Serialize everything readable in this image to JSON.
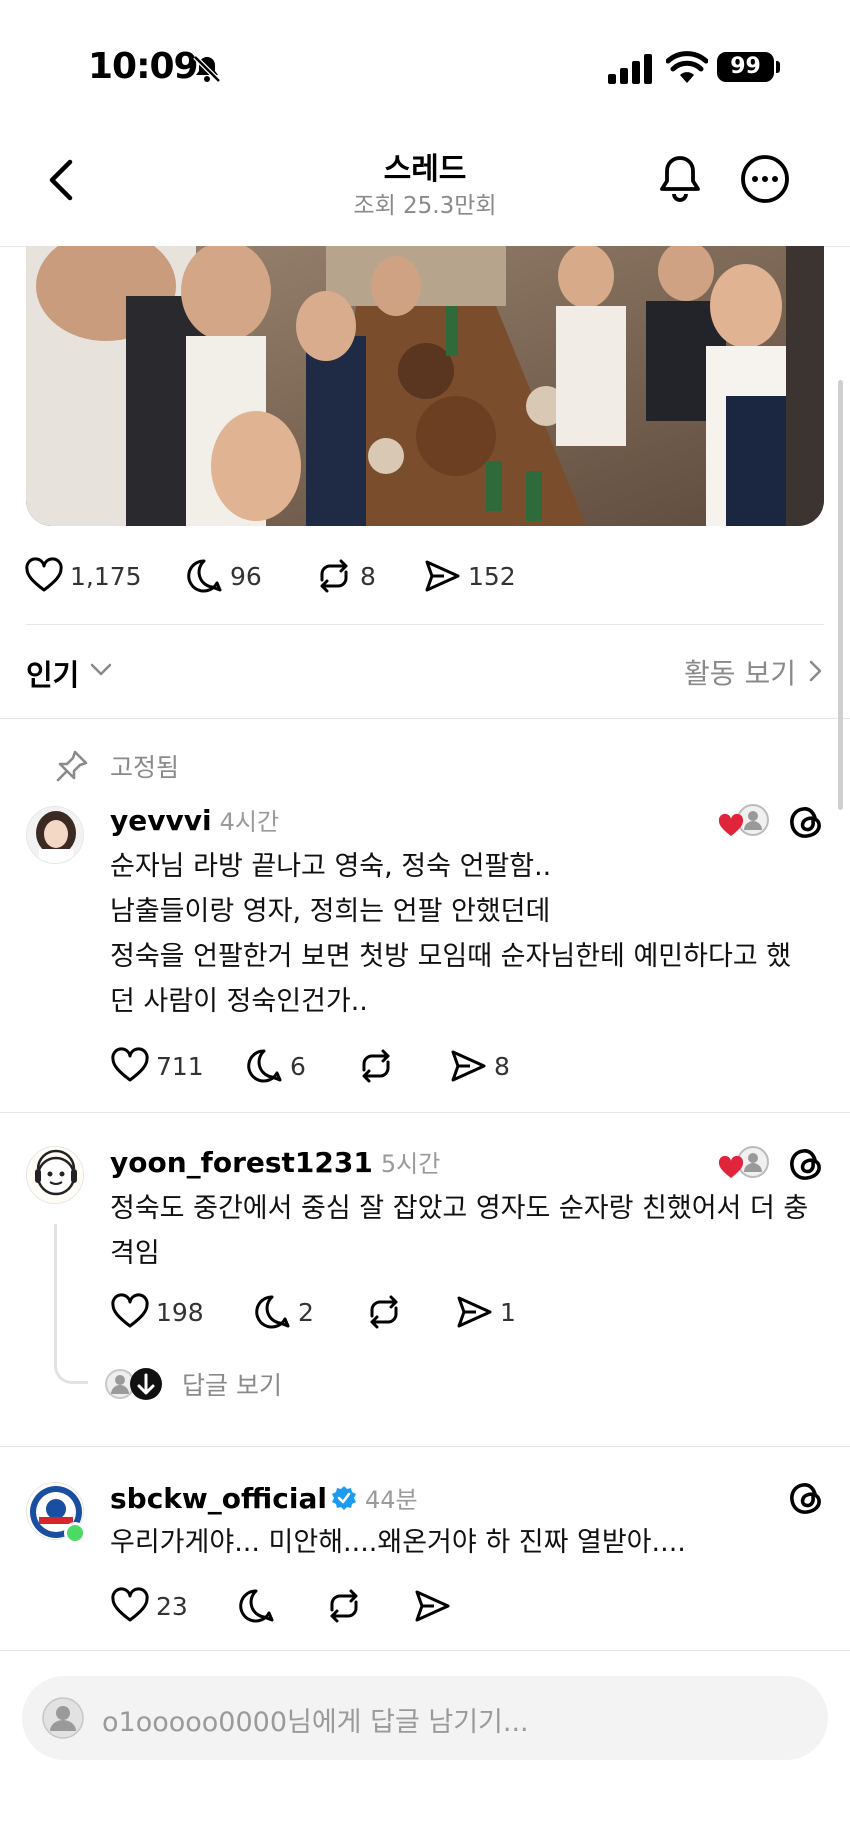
{
  "status_bar": {
    "time": "10:09",
    "battery": "99"
  },
  "header": {
    "title": "스레드",
    "subtitle": "조회 25.3만회"
  },
  "post_stats": {
    "likes": "1,175",
    "comments": "96",
    "reposts": "8",
    "shares": "152"
  },
  "sort": {
    "label": "인기",
    "activity_link": "활동 보기"
  },
  "pinned_label": "고정됨",
  "comments": [
    {
      "username": "yevvvi",
      "time_ago": "4시간",
      "lines": [
        "순자님 라방 끝나고 영숙, 정숙 언팔함..",
        "남출들이랑 영자, 정희는 언팔 안했던데",
        "정숙을 언팔한거 보면 첫방 모임때 순자님한테 예민하다고 했",
        "던 사람이 정숙인건가.."
      ],
      "likes": "711",
      "replies": "6",
      "reposts": "",
      "shares": "8"
    },
    {
      "username": "yoon_forest1231",
      "time_ago": "5시간",
      "lines": [
        "정숙도 중간에서 중심 잘 잡았고 영자도 순자랑 친했어서 더 충",
        "격임"
      ],
      "likes": "198",
      "replies": "2",
      "reposts": "",
      "shares": "1",
      "view_replies": "답글 보기"
    },
    {
      "username": "sbckw_official",
      "time_ago": "44분",
      "lines": [
        "우리가게야... 미안해....왜온거야 하 진짜 열받아...."
      ],
      "likes": "23",
      "replies": "",
      "reposts": "",
      "shares": ""
    }
  ],
  "reply_box": {
    "placeholder": "o1ooooo0000님에게 답글 남기기..."
  },
  "colors": {
    "heart_red": "#e0243b",
    "verified_blue": "#1d9bf0",
    "online_green": "#4cd964",
    "muted_gray": "#8a8a8a"
  }
}
